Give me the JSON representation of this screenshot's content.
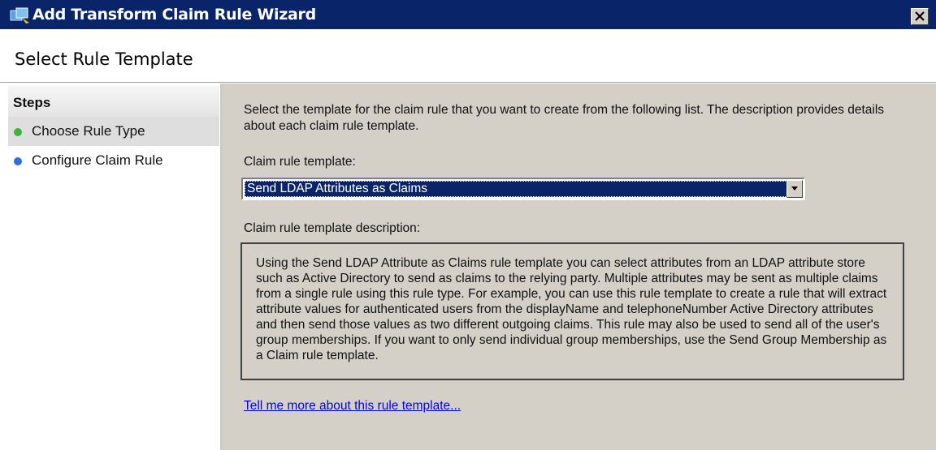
{
  "window": {
    "title": "Add Transform Claim Rule Wizard",
    "icon": "wizard-app-icon",
    "close_icon": "close-icon"
  },
  "header": {
    "title": "Select Rule Template"
  },
  "steps": {
    "heading": "Steps",
    "items": [
      {
        "label": "Choose Rule Type",
        "status": "current",
        "dot_color": "#3db33d"
      },
      {
        "label": "Configure Claim Rule",
        "status": "pending",
        "dot_color": "#2a6ee0"
      }
    ]
  },
  "main": {
    "intro": "Select the template for the claim rule that you want to create from the following list. The description provides details about each claim rule template.",
    "template_label": "Claim rule template:",
    "template_selected": "Send LDAP Attributes as Claims",
    "description_label": "Claim rule template description:",
    "description": "Using the Send LDAP Attribute as Claims rule template you can select attributes from an LDAP attribute store such as Active Directory to send as claims to the relying party. Multiple attributes may be sent as multiple claims from a single rule using this rule type. For example, you can use this rule template to create a rule that will extract attribute values for authenticated users from the displayName and telephoneNumber Active Directory attributes and then send those values as two different outgoing claims. This rule may also be used to send all of the user's group memberships. If you want to only send individual group memberships, use the Send Group Membership as a Claim rule template.",
    "more_link": "Tell me more about this rule template..."
  },
  "colors": {
    "titlebar": "#0a246a",
    "dialog_bg": "#d4d0c8",
    "selection": "#0a246a",
    "link": "#0000ee"
  }
}
